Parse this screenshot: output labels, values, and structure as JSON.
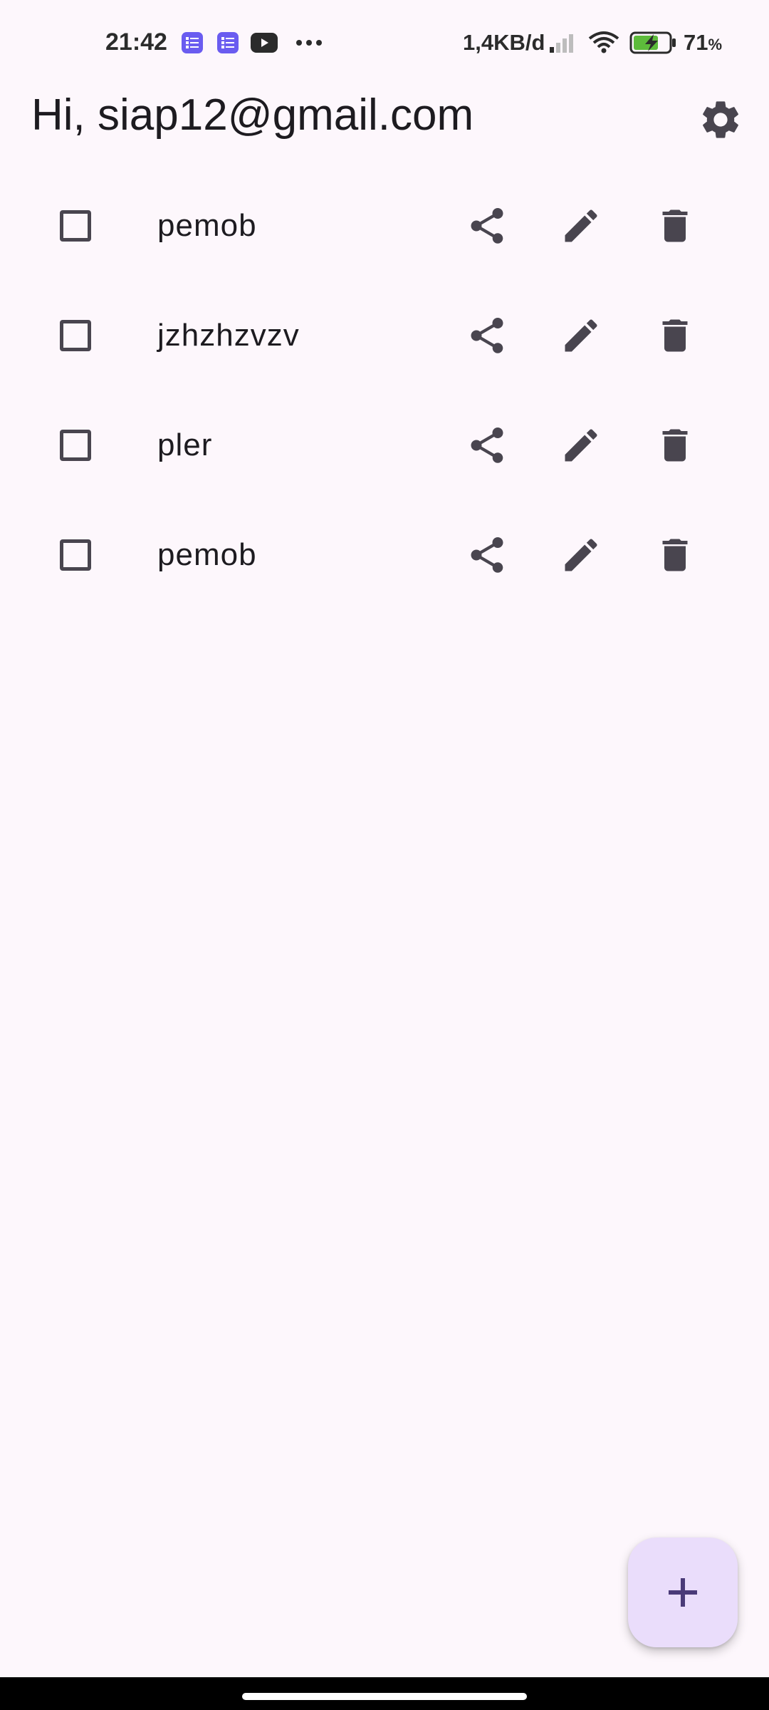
{
  "status_bar": {
    "time": "21:42",
    "network_speed": "1,4KB/d",
    "battery_value": "71",
    "battery_unit": "%",
    "icons": [
      "notes-app-icon",
      "notes-app-icon",
      "youtube-icon",
      "more-dots-icon",
      "signal-icon",
      "wifi-icon",
      "battery-charging-icon"
    ]
  },
  "header": {
    "greeting": "Hi, siap12@gmail.com",
    "settings_icon": "gear-icon"
  },
  "todos": [
    {
      "label": "pemob",
      "checked": false
    },
    {
      "label": "jzhzhzvzv",
      "checked": false
    },
    {
      "label": "pler",
      "checked": false
    },
    {
      "label": "pemob",
      "checked": false
    }
  ],
  "row_actions": [
    "share-icon",
    "edit-icon",
    "delete-icon"
  ],
  "fab": {
    "icon": "plus-icon"
  },
  "colors": {
    "background": "#fdf7fc",
    "icon": "#49454f",
    "fab": "#eaddfb",
    "fab_icon": "#4a3a78"
  }
}
